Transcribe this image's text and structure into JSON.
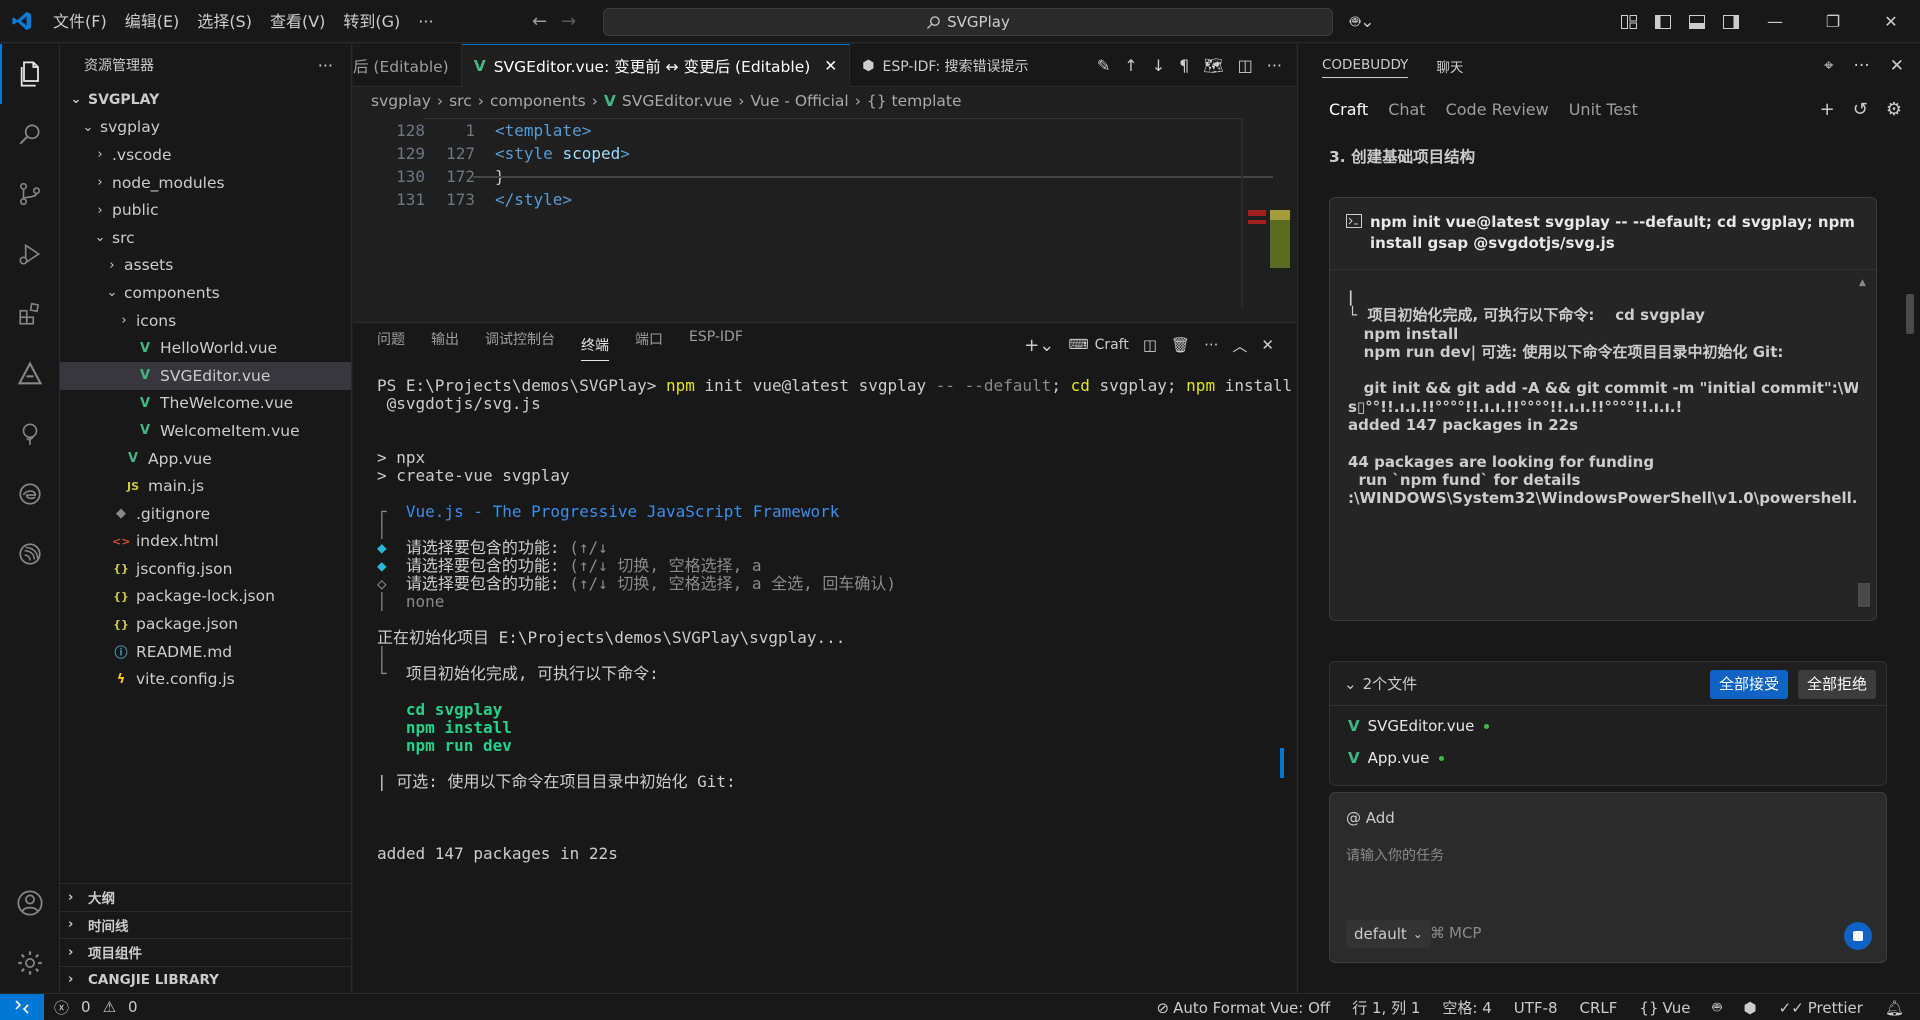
{
  "titlebar": {
    "menu": [
      "文件(F)",
      "编辑(E)",
      "选择(S)",
      "查看(V)",
      "转到(G)"
    ],
    "more": "···",
    "search_text": "SVGPlay"
  },
  "sidebar": {
    "title": "资源管理器",
    "more": "···",
    "root": "SVGPLAY",
    "items": [
      {
        "label": "svgplay",
        "depth": 1,
        "type": "folder-open"
      },
      {
        "label": ".vscode",
        "depth": 2,
        "type": "folder"
      },
      {
        "label": "node_modules",
        "depth": 2,
        "type": "folder"
      },
      {
        "label": "public",
        "depth": 2,
        "type": "folder"
      },
      {
        "label": "src",
        "depth": 2,
        "type": "folder-open"
      },
      {
        "label": "assets",
        "depth": 3,
        "type": "folder"
      },
      {
        "label": "components",
        "depth": 3,
        "type": "folder-open"
      },
      {
        "label": "icons",
        "depth": 4,
        "type": "folder"
      },
      {
        "label": "HelloWorld.vue",
        "depth": 4,
        "type": "vue"
      },
      {
        "label": "SVGEditor.vue",
        "depth": 4,
        "type": "vue",
        "selected": true
      },
      {
        "label": "TheWelcome.vue",
        "depth": 4,
        "type": "vue"
      },
      {
        "label": "WelcomeItem.vue",
        "depth": 4,
        "type": "vue"
      },
      {
        "label": "App.vue",
        "depth": 3,
        "type": "vue"
      },
      {
        "label": "main.js",
        "depth": 3,
        "type": "js"
      },
      {
        "label": ".gitignore",
        "depth": 2,
        "type": "git"
      },
      {
        "label": "index.html",
        "depth": 2,
        "type": "html"
      },
      {
        "label": "jsconfig.json",
        "depth": 2,
        "type": "json"
      },
      {
        "label": "package-lock.json",
        "depth": 2,
        "type": "json"
      },
      {
        "label": "package.json",
        "depth": 2,
        "type": "json"
      },
      {
        "label": "README.md",
        "depth": 2,
        "type": "info"
      },
      {
        "label": "vite.config.js",
        "depth": 2,
        "type": "vite"
      }
    ],
    "sections": [
      "大纲",
      "时间线",
      "项目组件",
      "CANGJIE LIBRARY"
    ]
  },
  "editor": {
    "tabs": [
      {
        "label": "后 (Editable)",
        "active": false
      },
      {
        "label": "SVGEditor.vue: 变更前 ↔ 变更后 (Editable)",
        "active": true,
        "close": "✕"
      },
      {
        "label": "ESP-IDF:  搜索错误提示",
        "active": false
      }
    ],
    "breadcrumb": [
      "svgplay",
      "src",
      "components",
      "SVGEditor.vue",
      "Vue - Official",
      "{} template"
    ],
    "lines": [
      {
        "ln1": "128",
        "ln2": "1",
        "parts": [
          [
            "tag",
            "<template>"
          ]
        ]
      },
      {
        "ln1": "129",
        "ln2": "127",
        "parts": [
          [
            "tag",
            "<style "
          ],
          [
            "attr",
            "scoped"
          ],
          [
            "tag",
            ">"
          ]
        ]
      },
      {
        "ln1": "130",
        "ln2": "172",
        "parts": [
          [
            "plain",
            "}"
          ]
        ]
      },
      {
        "ln1": "131",
        "ln2": "173",
        "parts": [
          [
            "tag",
            "</style>"
          ]
        ]
      }
    ]
  },
  "panel": {
    "tabs": [
      "问题",
      "输出",
      "调试控制台",
      "终端",
      "端口",
      "ESP-IDF"
    ],
    "active_tab": "终端",
    "terminal_name": "Craft",
    "terminal_lines": [
      [
        [
          "plain",
          "PS E:\\Projects\\demos\\SVGPlay> "
        ],
        [
          "yellow",
          "npm"
        ],
        [
          "plain",
          " init vue@latest svgplay "
        ],
        [
          "gray",
          "-- --default"
        ],
        [
          "plain",
          "; "
        ],
        [
          "yellow",
          "cd"
        ],
        [
          "plain",
          " svgplay; "
        ],
        [
          "yellow",
          "npm"
        ],
        [
          "plain",
          " install gsap"
        ]
      ],
      [
        [
          "plain",
          " @svgdotjs/svg.js"
        ]
      ],
      [
        [
          "plain",
          ""
        ]
      ],
      [
        [
          "plain",
          ""
        ]
      ],
      [
        [
          "plain",
          "> npx"
        ]
      ],
      [
        [
          "plain",
          "> create-vue svgplay"
        ]
      ],
      [
        [
          "plain",
          ""
        ]
      ],
      [
        [
          "gray",
          "┌  "
        ],
        [
          "blue",
          "Vue.js - The Progressive JavaScript Framework"
        ]
      ],
      [
        [
          "gray",
          "│"
        ]
      ],
      [
        [
          "cyan",
          "◆  "
        ],
        [
          "plain",
          "请选择要包含的功能: "
        ],
        [
          "gray",
          "(↑/↓"
        ]
      ],
      [
        [
          "cyan",
          "◆  "
        ],
        [
          "plain",
          "请选择要包含的功能: "
        ],
        [
          "gray",
          "(↑/↓ 切换, 空格选择, a"
        ]
      ],
      [
        [
          "gray",
          "◇  "
        ],
        [
          "plain",
          "请选择要包含的功能: "
        ],
        [
          "gray",
          "(↑/↓ 切换, 空格选择, a 全选, 回车确认)"
        ]
      ],
      [
        [
          "gray",
          "│  none"
        ]
      ],
      [
        [
          "plain",
          ""
        ]
      ],
      [
        [
          "plain",
          "正在初始化项目 E:\\Projects\\demos\\SVGPlay\\svgplay..."
        ]
      ],
      [
        [
          "gray",
          "│"
        ]
      ],
      [
        [
          "gray",
          "└  "
        ],
        [
          "plain",
          "项目初始化完成, 可执行以下命令:"
        ]
      ],
      [
        [
          "plain",
          ""
        ]
      ],
      [
        [
          "plain",
          "   "
        ],
        [
          "green",
          "cd svgplay"
        ]
      ],
      [
        [
          "plain",
          "   "
        ],
        [
          "green",
          "npm install"
        ]
      ],
      [
        [
          "plain",
          "   "
        ],
        [
          "green",
          "npm run dev"
        ]
      ],
      [
        [
          "plain",
          ""
        ]
      ],
      [
        [
          "plain",
          "| 可选: 使用以下命令在项目目录中初始化 Git:"
        ]
      ],
      [
        [
          "plain",
          ""
        ]
      ],
      [
        [
          "plain",
          ""
        ]
      ],
      [
        [
          "plain",
          ""
        ]
      ],
      [
        [
          "plain",
          "added 147 packages in 22s"
        ]
      ]
    ]
  },
  "chat": {
    "header_tabs": [
      "CODEBUDDY",
      "聊天"
    ],
    "mode_tabs": [
      "Craft",
      "Chat",
      "Code Review",
      "Unit Test"
    ],
    "active_mode": "Craft",
    "step": "3. 创建基础项目结构",
    "command": "npm init vue@latest svgplay -- --default; cd svgplay; npm install gsap @svgdotjs/svg.js",
    "output_lines": [
      "|",
      "└  项目初始化完成, 可执行以下命令:    cd svgplay",
      "   npm install",
      "   npm run dev| 可选: 使用以下命令在项目目录中初始化 Git:",
      "",
      "   git init && git add -A && git commit -m \"initial commit\":\\WIND",
      "s▯°°!!.ı.ı.!!°°°°!!.ı.ı.!!°°°°!!.ı.ı.!!°°°°!!.ı.ı.!",
      "added 147 packages in 22s",
      "",
      "44 packages are looking for funding",
      "  run `npm fund` for details",
      ":\\WINDOWS\\System32\\WindowsPowerShell\\v1.0\\powershell.exe▯"
    ],
    "files_header": "2个文件",
    "accept_all": "全部接受",
    "reject_all": "全部拒绝",
    "files": [
      "SVGEditor.vue",
      "App.vue"
    ],
    "at_add": "@ Add",
    "input_placeholder": "请输入你的任务",
    "model": "default",
    "mcp": "MCP"
  },
  "statusbar": {
    "errors": "0",
    "warnings": "0",
    "auto_format": "Auto Format Vue: Off",
    "position": "行 1, 列 1",
    "spaces": "空格: 4",
    "encoding": "UTF-8",
    "eol": "CRLF",
    "language": "Vue",
    "prettier": "Prettier"
  }
}
